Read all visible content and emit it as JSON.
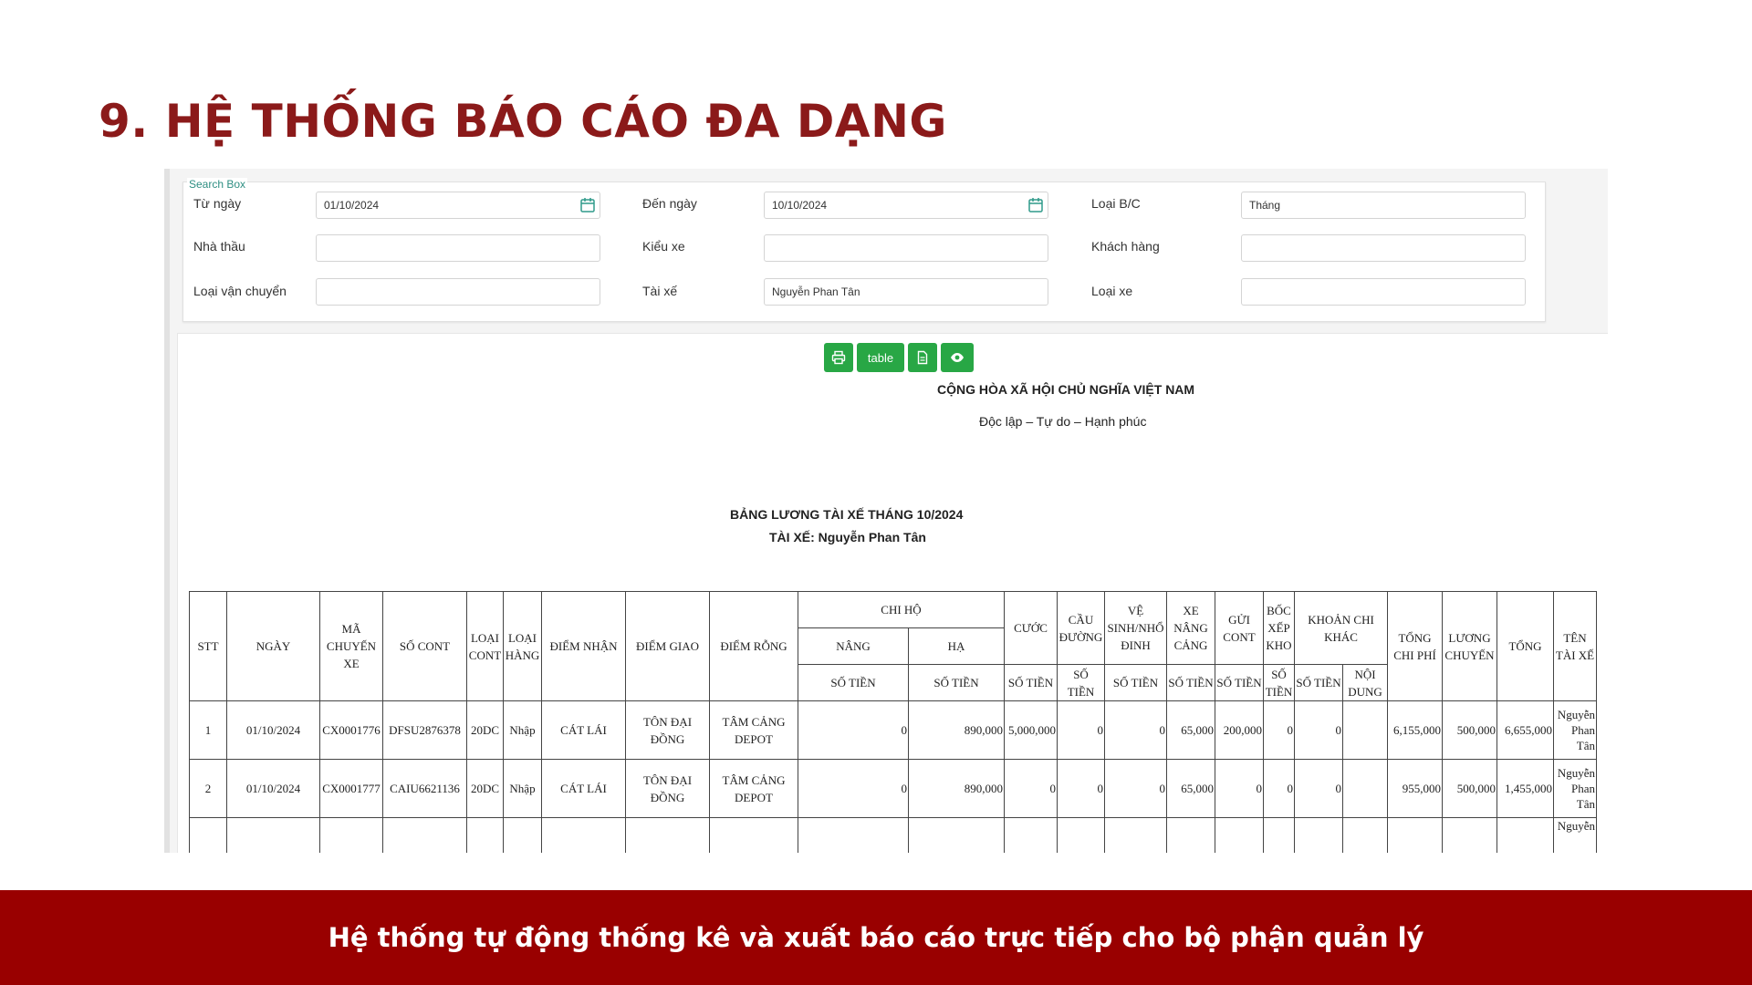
{
  "slide": {
    "title": "9. HỆ THỐNG BÁO CÁO ĐA DẠNG",
    "footer": "Hệ thống tự động thống kê và xuất báo cáo trực tiếp cho bộ phận quản lý"
  },
  "search": {
    "legend": "Search Box",
    "from_date_label": "Từ ngày",
    "from_date_value": "01/10/2024",
    "to_date_label": "Đến ngày",
    "to_date_value": "10/10/2024",
    "report_type_label": "Loại B/C",
    "report_type_value": "Tháng",
    "contractor_label": "Nhà thầu",
    "contractor_value": "",
    "vehicle_style_label": "Kiểu xe",
    "vehicle_style_value": "",
    "customer_label": "Khách hàng",
    "customer_value": "",
    "transport_type_label": "Loại vận chuyển",
    "transport_type_value": "",
    "driver_label": "Tài xế",
    "driver_value": "Nguyễn Phan Tân",
    "vehicle_type_label": "Loại xe",
    "vehicle_type_value": ""
  },
  "toolbar": {
    "print_icon": "printer-icon",
    "table_label": "table",
    "export_icon": "document-icon",
    "preview_icon": "eye-icon"
  },
  "report": {
    "nation": "CỘNG HÒA XÃ HỘI CHỦ NGHĨA VIỆT NAM",
    "motto": "Độc lập – Tự do – Hạnh phúc",
    "title": "BẢNG LƯƠNG TÀI XẾ THÁNG 10/2024",
    "driver_line": "TÀI XẾ: Nguyễn Phan Tân"
  },
  "table": {
    "headers": {
      "stt": "STT",
      "ngay": "NGÀY",
      "ma_chuyen_xe": "MÃ CHUYẾN XE",
      "so_cont": "SỐ CONT",
      "loai_cont": "LOẠI CONT",
      "loai_hang": "LOẠI HÀNG",
      "diem_nhan": "ĐIỂM NHẬN",
      "diem_giao": "ĐIỂM GIAO",
      "diem_rong": "ĐIỂM RỖNG",
      "chi_ho": "CHI HỘ",
      "nang": "NÂNG",
      "ha": "HẠ",
      "so_tien": "SỐ TIỀN",
      "cuoc": "CƯỚC",
      "cau_duong": "CẦU ĐƯỜNG",
      "ve_sinh": "VỆ SINH/NHỔ ĐINH",
      "xe_nang_cang": "XE NÂNG CẢNG",
      "gui_cont": "GỬI CONT",
      "boc_xep_kho": "BỐC XẾP KHO",
      "khoan_chi_khac": "KHOẢN CHI KHÁC",
      "noi_dung": "NỘI DUNG",
      "tong_chi_phi": "TỔNG CHI PHÍ",
      "luong_chuyen": "LƯƠNG CHUYẾN",
      "tong": "TỔNG",
      "ten_tai_xe": "TÊN TÀI XẾ"
    },
    "rows": [
      {
        "stt": "1",
        "ngay": "01/10/2024",
        "ma_chuyen_xe": "CX0001776",
        "so_cont": "DFSU2876378",
        "loai_cont": "20DC",
        "loai_hang": "Nhập",
        "diem_nhan": "CÁT LÁI",
        "diem_giao": "TÔN ĐẠI ĐỒNG",
        "diem_rong": "TÂM CẢNG DEPOT",
        "nang": "0",
        "ha": "890,000",
        "cuoc": "5,000,000",
        "cau_duong": "0",
        "ve_sinh": "0",
        "xe_nang_cang": "65,000",
        "gui_cont": "200,000",
        "boc_xep_kho": "0",
        "khac_so_tien": "0",
        "noi_dung": "",
        "tong_chi_phi": "6,155,000",
        "luong_chuyen": "500,000",
        "tong": "6,655,000",
        "ten_tai_xe": "Nguyễn Phan Tân"
      },
      {
        "stt": "2",
        "ngay": "01/10/2024",
        "ma_chuyen_xe": "CX0001777",
        "so_cont": "CAIU6621136",
        "loai_cont": "20DC",
        "loai_hang": "Nhập",
        "diem_nhan": "CÁT LÁI",
        "diem_giao": "TÔN ĐẠI ĐỒNG",
        "diem_rong": "TÂM CẢNG DEPOT",
        "nang": "0",
        "ha": "890,000",
        "cuoc": "0",
        "cau_duong": "0",
        "ve_sinh": "0",
        "xe_nang_cang": "65,000",
        "gui_cont": "0",
        "boc_xep_kho": "0",
        "khac_so_tien": "0",
        "noi_dung": "",
        "tong_chi_phi": "955,000",
        "luong_chuyen": "500,000",
        "tong": "1,455,000",
        "ten_tai_xe": "Nguyễn Phan Tân"
      },
      {
        "stt": "",
        "ngay": "",
        "ma_chuyen_xe": "",
        "so_cont": "",
        "loai_cont": "",
        "loai_hang": "",
        "diem_nhan": "",
        "diem_giao": "",
        "diem_rong": "",
        "nang": "",
        "ha": "",
        "cuoc": "",
        "cau_duong": "",
        "ve_sinh": "",
        "xe_nang_cang": "",
        "gui_cont": "",
        "boc_xep_kho": "",
        "khac_so_tien": "",
        "noi_dung": "",
        "tong_chi_phi": "",
        "luong_chuyen": "",
        "tong": "",
        "ten_tai_xe": "Nguyễn"
      }
    ]
  }
}
